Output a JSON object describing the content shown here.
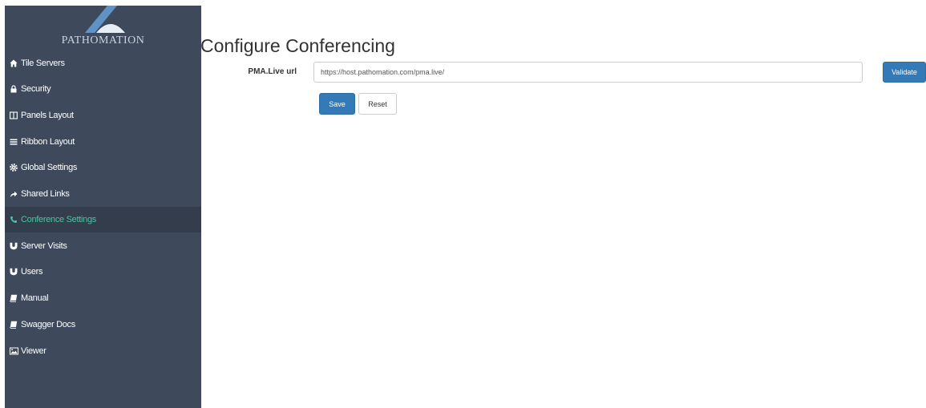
{
  "brand": {
    "name": "PATHOMATION"
  },
  "sidebar": {
    "items": [
      {
        "label": "Tile Servers",
        "icon": "home-icon"
      },
      {
        "label": "Security",
        "icon": "lock-icon"
      },
      {
        "label": "Panels Layout",
        "icon": "columns-icon"
      },
      {
        "label": "Ribbon Layout",
        "icon": "bars-icon"
      },
      {
        "label": "Global Settings",
        "icon": "gear-icon"
      },
      {
        "label": "Shared Links",
        "icon": "share-icon"
      },
      {
        "label": "Conference Settings",
        "icon": "phone-icon",
        "active": true
      },
      {
        "label": "Server Visits",
        "icon": "users-icon"
      },
      {
        "label": "Users",
        "icon": "users-icon"
      },
      {
        "label": "Manual",
        "icon": "book-icon"
      },
      {
        "label": "Swagger Docs",
        "icon": "book-icon"
      },
      {
        "label": "Viewer",
        "icon": "image-icon"
      }
    ]
  },
  "main": {
    "title": "Configure Conferencing",
    "form": {
      "pma_label": "PMA.Live url",
      "pma_value": "https://host.pathomation.com/pma.live/",
      "validate_label": "Validate",
      "save_label": "Save",
      "reset_label": "Reset"
    }
  },
  "colors": {
    "sidebar_bg": "#3e4a5b",
    "sidebar_active_bg": "#333d4b",
    "sidebar_active_text": "#4ec2a3",
    "primary": "#337ab7"
  }
}
